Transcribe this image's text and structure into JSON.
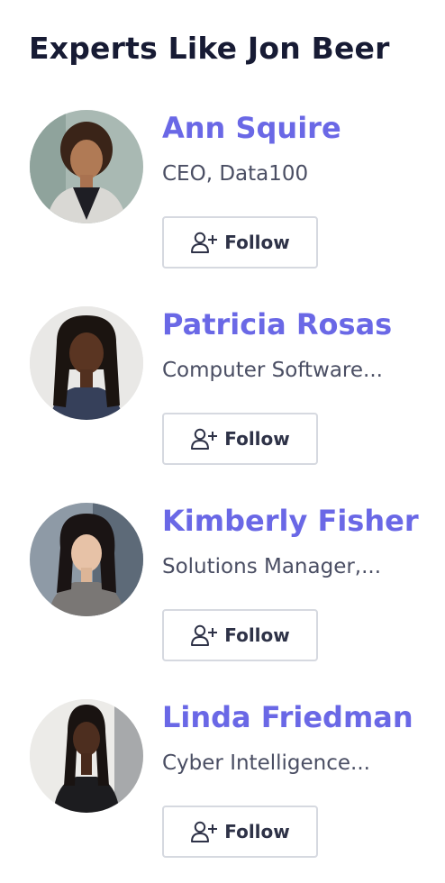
{
  "heading": "Experts Like Jon Beer",
  "follow_label": "Follow",
  "icons": {
    "follow": "add-user-icon"
  },
  "colors": {
    "name": "#6a68e6",
    "heading": "#171b34",
    "subtitle": "#4a4e63",
    "button_border": "#d6d9e0"
  },
  "experts": [
    {
      "name": "Ann Squire",
      "title": "CEO, Data100"
    },
    {
      "name": "Patricia Rosas",
      "title": "Computer Software..."
    },
    {
      "name": "Kimberly Fisher",
      "title": "Solutions Manager,..."
    },
    {
      "name": "Linda Friedman",
      "title": "Cyber Intelligence..."
    }
  ]
}
